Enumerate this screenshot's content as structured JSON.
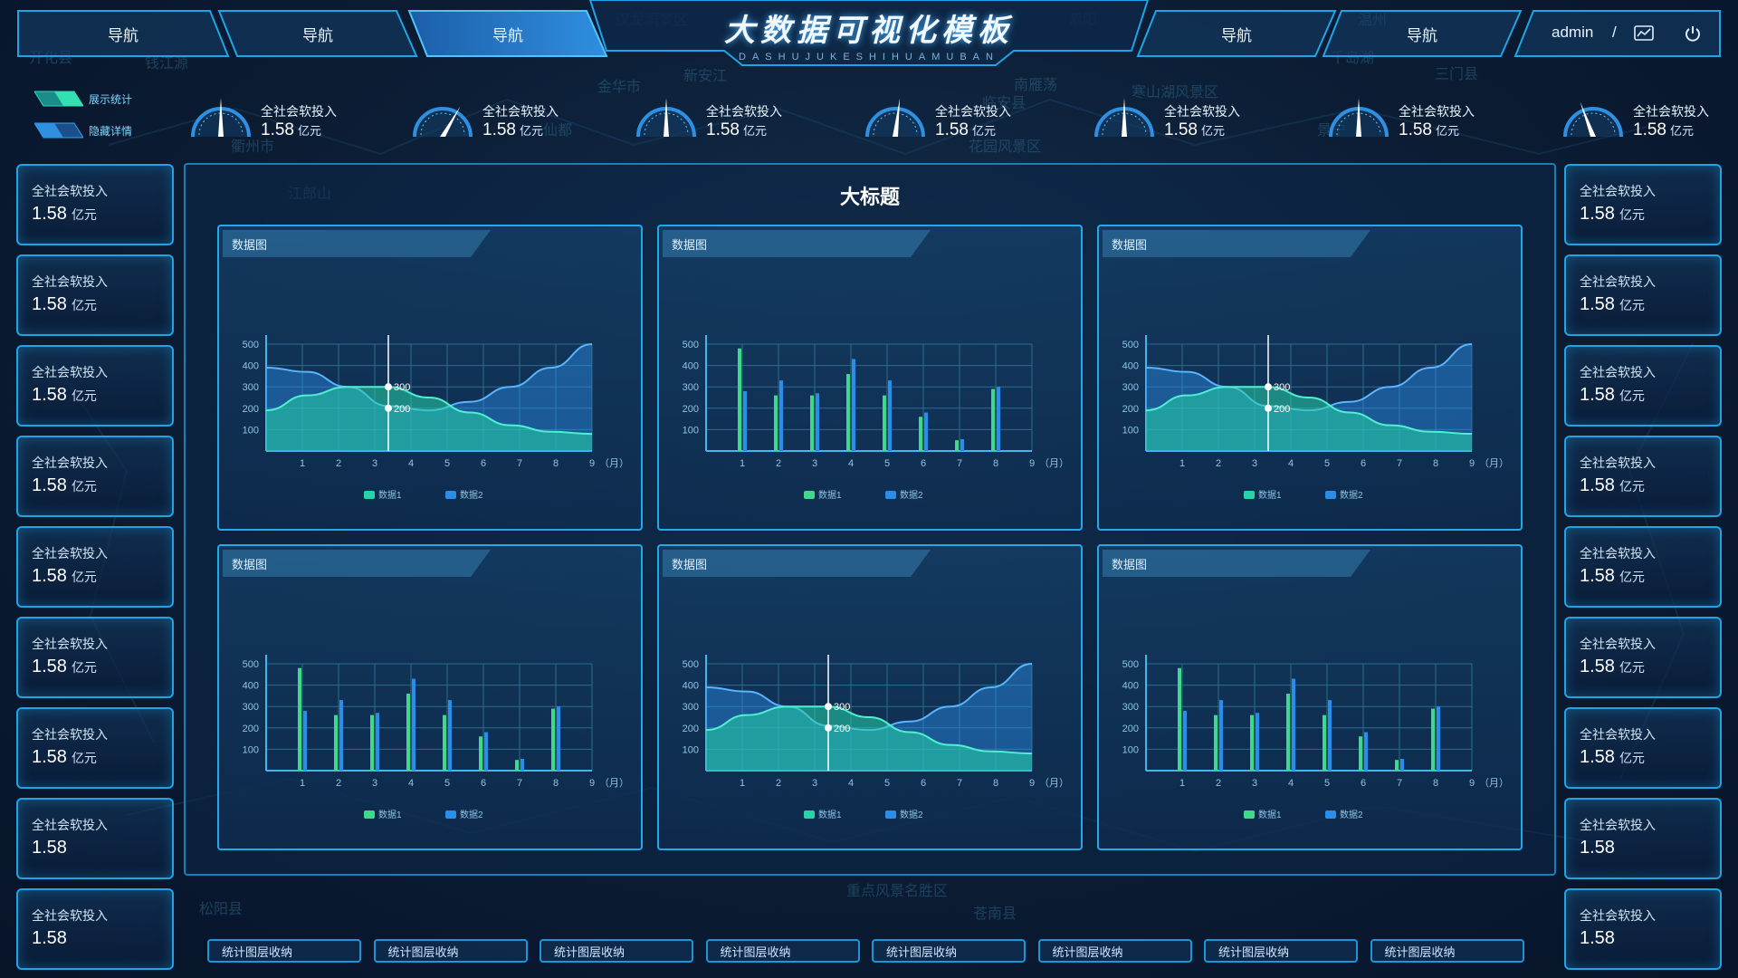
{
  "header": {
    "title": "大数据可视化模板",
    "subtitle": "DASHUJUKESHIHUAMUBAN",
    "nav_left": [
      "导航",
      "导航",
      "导航"
    ],
    "nav_right": [
      "导航",
      "导航"
    ],
    "active_index": 2,
    "user": "admin",
    "separator": "/"
  },
  "toggles": [
    {
      "label": "展示统计"
    },
    {
      "label": "隐藏详情"
    }
  ],
  "gauges": [
    {
      "label": "全社会软投入",
      "value": "1.58",
      "unit": "亿元",
      "needle": 0.5
    },
    {
      "label": "全社会软投入",
      "value": "1.58",
      "unit": "亿元",
      "needle": 0.72
    },
    {
      "label": "全社会软投入",
      "value": "1.58",
      "unit": "亿元",
      "needle": 0.5
    },
    {
      "label": "全社会软投入",
      "value": "1.58",
      "unit": "亿元",
      "needle": 0.55
    },
    {
      "label": "全社会软投入",
      "value": "1.58",
      "unit": "亿元",
      "needle": 0.5
    },
    {
      "label": "全社会软投入",
      "value": "1.58",
      "unit": "亿元",
      "needle": 0.5
    },
    {
      "label": "全社会软投入",
      "value": "1.58",
      "unit": "亿元",
      "needle": 0.35
    }
  ],
  "left_cards": [
    {
      "label": "全社会软投入",
      "value": "1.58",
      "unit": "亿元"
    },
    {
      "label": "全社会软投入",
      "value": "1.58",
      "unit": "亿元"
    },
    {
      "label": "全社会软投入",
      "value": "1.58",
      "unit": "亿元"
    },
    {
      "label": "全社会软投入",
      "value": "1.58",
      "unit": "亿元"
    },
    {
      "label": "全社会软投入",
      "value": "1.58",
      "unit": "亿元"
    },
    {
      "label": "全社会软投入",
      "value": "1.58",
      "unit": "亿元"
    },
    {
      "label": "全社会软投入",
      "value": "1.58",
      "unit": "亿元"
    },
    {
      "label": "全社会软投入",
      "value": "1.58",
      "unit": ""
    },
    {
      "label": "全社会软投入",
      "value": "1.58",
      "unit": ""
    }
  ],
  "right_cards": [
    {
      "label": "全社会软投入",
      "value": "1.58",
      "unit": "亿元"
    },
    {
      "label": "全社会软投入",
      "value": "1.58",
      "unit": "亿元"
    },
    {
      "label": "全社会软投入",
      "value": "1.58",
      "unit": "亿元"
    },
    {
      "label": "全社会软投入",
      "value": "1.58",
      "unit": "亿元"
    },
    {
      "label": "全社会软投入",
      "value": "1.58",
      "unit": "亿元"
    },
    {
      "label": "全社会软投入",
      "value": "1.58",
      "unit": "亿元"
    },
    {
      "label": "全社会软投入",
      "value": "1.58",
      "unit": "亿元"
    },
    {
      "label": "全社会软投入",
      "value": "1.58",
      "unit": ""
    },
    {
      "label": "全社会软投入",
      "value": "1.58",
      "unit": ""
    }
  ],
  "main": {
    "title": "大标题"
  },
  "map_labels": [
    "汉龙洞景区",
    "钱江源",
    "金华市",
    "寒山湖风景区",
    "衢州市",
    "临安县",
    "紫阳",
    "江郎山",
    "花园风景区",
    "南雁荡",
    "松阳县",
    "温州",
    "重点风景名胜区",
    "仙都",
    "新安江",
    "千岛湖",
    "开化县",
    "三门县",
    "苍南县",
    "景宁"
  ],
  "chart_data": [
    {
      "type": "area",
      "title": "数据图",
      "categories": [
        "1",
        "2",
        "3",
        "4",
        "5",
        "6",
        "7",
        "8",
        "9"
      ],
      "xlabel_suffix": "（月）",
      "ylim": [
        0,
        500
      ],
      "yticks": [
        100,
        200,
        300,
        400,
        500
      ],
      "series": [
        {
          "name": "数据1",
          "values": [
            190,
            260,
            300,
            300,
            250,
            180,
            120,
            90,
            80
          ]
        },
        {
          "name": "数据2",
          "values": [
            390,
            370,
            300,
            210,
            190,
            230,
            300,
            390,
            500
          ]
        }
      ],
      "annotations": [
        "300",
        "200"
      ],
      "highlight_x": "4"
    },
    {
      "type": "bar",
      "title": "数据图",
      "categories": [
        "1",
        "2",
        "3",
        "4",
        "5",
        "6",
        "7",
        "8",
        "9"
      ],
      "xlabel_suffix": "（月）",
      "ylim": [
        0,
        500
      ],
      "yticks": [
        100,
        200,
        300,
        400,
        500
      ],
      "series": [
        {
          "name": "数据1",
          "values": [
            480,
            260,
            260,
            360,
            260,
            160,
            50,
            290
          ]
        },
        {
          "name": "数据2",
          "values": [
            280,
            330,
            270,
            430,
            330,
            180,
            55,
            300
          ]
        }
      ]
    },
    {
      "type": "area",
      "title": "数据图",
      "categories": [
        "1",
        "2",
        "3",
        "4",
        "5",
        "6",
        "7",
        "8",
        "9"
      ],
      "xlabel_suffix": "（月）",
      "ylim": [
        0,
        500
      ],
      "yticks": [
        100,
        200,
        300,
        400,
        500
      ],
      "series": [
        {
          "name": "数据1",
          "values": [
            190,
            260,
            300,
            300,
            250,
            180,
            120,
            90,
            80
          ]
        },
        {
          "name": "数据2",
          "values": [
            390,
            370,
            300,
            210,
            190,
            230,
            300,
            390,
            500
          ]
        }
      ],
      "annotations": [
        "300",
        "200"
      ],
      "highlight_x": "4"
    },
    {
      "type": "bar",
      "title": "数据图",
      "categories": [
        "1",
        "2",
        "3",
        "4",
        "5",
        "6",
        "7",
        "8",
        "9"
      ],
      "xlabel_suffix": "（月）",
      "ylim": [
        0,
        500
      ],
      "yticks": [
        100,
        200,
        300,
        400,
        500
      ],
      "series": [
        {
          "name": "数据1",
          "values": [
            480,
            260,
            260,
            360,
            260,
            160,
            50,
            290
          ]
        },
        {
          "name": "数据2",
          "values": [
            280,
            330,
            270,
            430,
            330,
            180,
            55,
            300
          ]
        }
      ]
    },
    {
      "type": "area",
      "title": "数据图",
      "categories": [
        "1",
        "2",
        "3",
        "4",
        "5",
        "6",
        "7",
        "8",
        "9"
      ],
      "xlabel_suffix": "（月）",
      "ylim": [
        0,
        500
      ],
      "yticks": [
        100,
        200,
        300,
        400,
        500
      ],
      "series": [
        {
          "name": "数据1",
          "values": [
            190,
            260,
            300,
            300,
            250,
            180,
            120,
            90,
            80
          ]
        },
        {
          "name": "数据2",
          "values": [
            390,
            370,
            300,
            210,
            190,
            230,
            300,
            390,
            500
          ]
        }
      ],
      "annotations": [
        "300",
        "200"
      ],
      "highlight_x": "4"
    },
    {
      "type": "bar",
      "title": "数据图",
      "categories": [
        "1",
        "2",
        "3",
        "4",
        "5",
        "6",
        "7",
        "8",
        "9"
      ],
      "xlabel_suffix": "（月）",
      "ylim": [
        0,
        500
      ],
      "yticks": [
        100,
        200,
        300,
        400,
        500
      ],
      "series": [
        {
          "name": "数据1",
          "values": [
            480,
            260,
            260,
            360,
            260,
            160,
            50,
            290
          ]
        },
        {
          "name": "数据2",
          "values": [
            280,
            330,
            270,
            430,
            330,
            180,
            55,
            300
          ]
        }
      ]
    }
  ],
  "bottom_buttons": [
    "统计图层收纳",
    "统计图层收纳",
    "统计图层收纳",
    "统计图层收纳",
    "统计图层收纳",
    "统计图层收纳",
    "统计图层收纳",
    "统计图层收纳"
  ],
  "colors": {
    "accent": "#22a9ea",
    "series1": "#27d3a8",
    "series2": "#2a8ee8",
    "bar1": "#3fd98a",
    "bar2": "#2a8ee8"
  }
}
